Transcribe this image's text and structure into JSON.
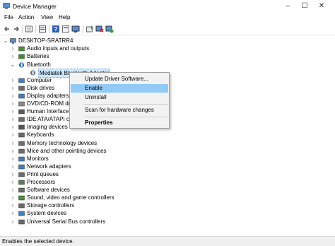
{
  "window": {
    "title": "Device Manager",
    "icon": "device-manager-icon"
  },
  "menu": [
    "File",
    "Action",
    "View",
    "Help"
  ],
  "toolbar": [
    "back-arrow-icon",
    "forward-arrow-icon",
    "properties-icon",
    "show-hidden-icon",
    "help-icon",
    "action-icon",
    "monitor-icon",
    "update-driver-icon",
    "disable-device-icon",
    "scan-hardware-icon"
  ],
  "tree": {
    "root": "DESKTOP-SRATRR4",
    "items": [
      {
        "label": "Audio inputs and outputs",
        "icon": "audio-icon",
        "color": "#4a8f3c"
      },
      {
        "label": "Batteries",
        "icon": "battery-icon",
        "color": "#3b8f3b"
      },
      {
        "label": "Bluetooth",
        "icon": "bluetooth-icon",
        "color": "#1e63c8",
        "expanded": true
      },
      {
        "label": "Mediatek Bluetooth Adaptor",
        "icon": "bluetooth-device-icon",
        "color": "#5b6e86",
        "child": true,
        "selected": true
      },
      {
        "label": "Computer",
        "icon": "computer-icon",
        "color": "#3f7fbf"
      },
      {
        "label": "Disk drives",
        "icon": "disk-drive-icon",
        "color": "#6b6b6b"
      },
      {
        "label": "Display adapters",
        "icon": "display-adapter-icon",
        "color": "#3f7fbf"
      },
      {
        "label": "DVD/CD-ROM drives",
        "icon": "dvd-icon",
        "color": "#8a8a8a"
      },
      {
        "label": "Human Interface Devices",
        "icon": "hid-icon",
        "color": "#5a5a5a"
      },
      {
        "label": "IDE ATA/ATAPI controllers",
        "icon": "ide-icon",
        "color": "#6b6b6b"
      },
      {
        "label": "Imaging devices",
        "icon": "camera-icon",
        "color": "#555555"
      },
      {
        "label": "Keyboards",
        "icon": "keyboard-icon",
        "color": "#6b6b6b"
      },
      {
        "label": "Memory technology devices",
        "icon": "memory-icon",
        "color": "#6b6b6b"
      },
      {
        "label": "Mice and other pointing devices",
        "icon": "mouse-icon",
        "color": "#6b6b6b"
      },
      {
        "label": "Monitors",
        "icon": "monitor-icon",
        "color": "#3f7fbf"
      },
      {
        "label": "Network adapters",
        "icon": "network-icon",
        "color": "#3f7fbf"
      },
      {
        "label": "Print queues",
        "icon": "printer-icon",
        "color": "#6b6b6b"
      },
      {
        "label": "Processors",
        "icon": "processor-icon",
        "color": "#5a7a5a"
      },
      {
        "label": "Software devices",
        "icon": "software-device-icon",
        "color": "#6b6b6b"
      },
      {
        "label": "Sound, video and game controllers",
        "icon": "sound-icon",
        "color": "#4a8f3c"
      },
      {
        "label": "Storage controllers",
        "icon": "storage-icon",
        "color": "#6b6b6b"
      },
      {
        "label": "System devices",
        "icon": "system-device-icon",
        "color": "#3f7fbf"
      },
      {
        "label": "Universal Serial Bus controllers",
        "icon": "usb-icon",
        "color": "#6b6b6b"
      }
    ]
  },
  "context_menu": {
    "items": [
      {
        "label": "Update Driver Software..."
      },
      {
        "label": "Enable",
        "highlighted": true
      },
      {
        "label": "Uninstall"
      },
      {
        "separator": true
      },
      {
        "label": "Scan for hardware changes"
      },
      {
        "separator": true
      },
      {
        "label": "Properties",
        "bold": true
      }
    ]
  },
  "status": "Enables the selected device.",
  "colors": {
    "highlight": "#91c9f7",
    "selection": "#cce8ff"
  }
}
